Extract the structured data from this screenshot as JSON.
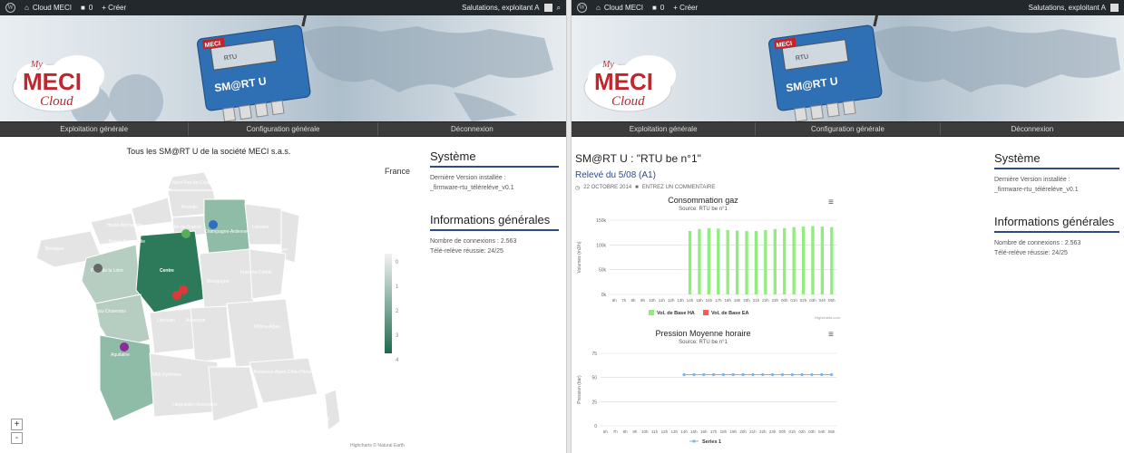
{
  "left": {
    "adminbar": {
      "site": "Cloud MECI",
      "comments": "0",
      "create": "+ Créer",
      "greeting": "Salutations, exploitant A"
    },
    "banner": {
      "logo_top": "My",
      "logo_main": "MECI",
      "logo_sub": "Cloud",
      "device_brand": "MECI",
      "device_model": "SM@RT U",
      "device_screen": "RTU"
    },
    "menu": [
      "Exploitation générale",
      "Configuration générale",
      "Déconnexion"
    ],
    "map": {
      "title": "Tous les SM@RT U de la société  MECI s.a.s.",
      "country": "France",
      "credit": "Highcharts © Natural Earth",
      "zoom_in": "+",
      "zoom_out": "-",
      "legend_ticks": [
        "0",
        "1",
        "2",
        "3",
        "4"
      ],
      "regions": [
        "Nord-Pas-de-Calais",
        "Picardie",
        "Haute-Normandie",
        "Basse-Normandie",
        "Bretagne",
        "Ile-de-France",
        "Champagne-Ardenne",
        "Lorraine",
        "Alsace",
        "Pays de la Loire",
        "Centre",
        "Bourgogne",
        "Franche-Comté",
        "Poitou-Charentes",
        "Limousin",
        "Auvergne",
        "Rhône-Alpes",
        "Aquitaine",
        "Midi-Pyrénées",
        "Languedoc-Roussillon",
        "Provence-Alpes-Côte-d'Azur",
        "Corse"
      ]
    },
    "side": {
      "systeme_title": "Système",
      "version_label": "Dernière Version installée :",
      "version_value": "_firmware-rtu_téléreléve_v0.1",
      "info_title": "Informations générales",
      "connections": "Nombre de connexions : 2.563",
      "releve": "Télé-relève réussie: 24/25"
    }
  },
  "right": {
    "adminbar": {
      "site": "Cloud MECI",
      "comments": "0",
      "create": "+ Créer",
      "greeting": "Salutations, exploitant A"
    },
    "menu": [
      "Exploitation générale",
      "Configuration générale",
      "Déconnexion"
    ],
    "page_title": "SM@RT U : \"RTU be n°1\"",
    "post_title": "Relevé du 5/08 (A1)",
    "post_meta_date": "22 OCTOBRE 2014",
    "post_meta_comment": "ENTREZ UN COMMENTAIRE",
    "side": {
      "systeme_title": "Système",
      "version_label": "Dernière Version installée :",
      "version_value": "_firmware-rtu_téléreléve_v0.1",
      "info_title": "Informations générales",
      "connections": "Nombre de connexions : 2.563",
      "releve": "Télé-relève réussie: 24/25"
    }
  },
  "chart_data": [
    {
      "type": "bar",
      "title": "Consommation gaz",
      "subtitle": "Source: RTU be n°1",
      "ylabel": "Volumes (m3/h)",
      "ylim": [
        0,
        150000
      ],
      "yticks": [
        "0k",
        "50k",
        "100k",
        "150k"
      ],
      "categories": [
        "6h",
        "7h",
        "8h",
        "9h",
        "10h",
        "11h",
        "12h",
        "13h",
        "14h",
        "15h",
        "16h",
        "17h",
        "18h",
        "19h",
        "20h",
        "21h",
        "22h",
        "23h",
        "00h",
        "01h",
        "02h",
        "03h",
        "04h",
        "05h"
      ],
      "series": [
        {
          "name": "Vol. de Base HA",
          "color": "#90ed7d",
          "values": [
            0,
            0,
            0,
            0,
            0,
            0,
            0,
            0,
            128000,
            132000,
            134000,
            133000,
            130000,
            129000,
            128000,
            128000,
            130000,
            132000,
            134000,
            136000,
            137000,
            138000,
            137000,
            136000
          ]
        },
        {
          "name": "Vol. de Base EA",
          "color": "#f45b5b",
          "values": [
            0,
            0,
            0,
            0,
            0,
            0,
            0,
            0,
            0,
            0,
            0,
            0,
            0,
            0,
            0,
            0,
            0,
            0,
            0,
            0,
            0,
            0,
            0,
            0
          ]
        }
      ],
      "credit": "Highcharts.com"
    },
    {
      "type": "line",
      "title": "Pression Moyenne horaire",
      "subtitle": "Source: RTU be n°1",
      "ylabel": "Pression (bar)",
      "ylim": [
        0,
        75
      ],
      "yticks": [
        "0",
        "25",
        "50",
        "75"
      ],
      "categories": [
        "6h",
        "7h",
        "8h",
        "9h",
        "10h",
        "11h",
        "12h",
        "13h",
        "14h",
        "15h",
        "16h",
        "17h",
        "18h",
        "19h",
        "20h",
        "21h",
        "22h",
        "23h",
        "00h",
        "01h",
        "02h",
        "03h",
        "04h",
        "05h"
      ],
      "series": [
        {
          "name": "Series 1",
          "color": "#7cb5ec",
          "values": [
            null,
            null,
            null,
            null,
            null,
            null,
            null,
            null,
            53,
            53,
            53,
            53,
            53,
            53,
            53,
            53,
            53,
            53,
            53,
            53,
            53,
            53,
            53,
            53
          ]
        }
      ]
    }
  ]
}
